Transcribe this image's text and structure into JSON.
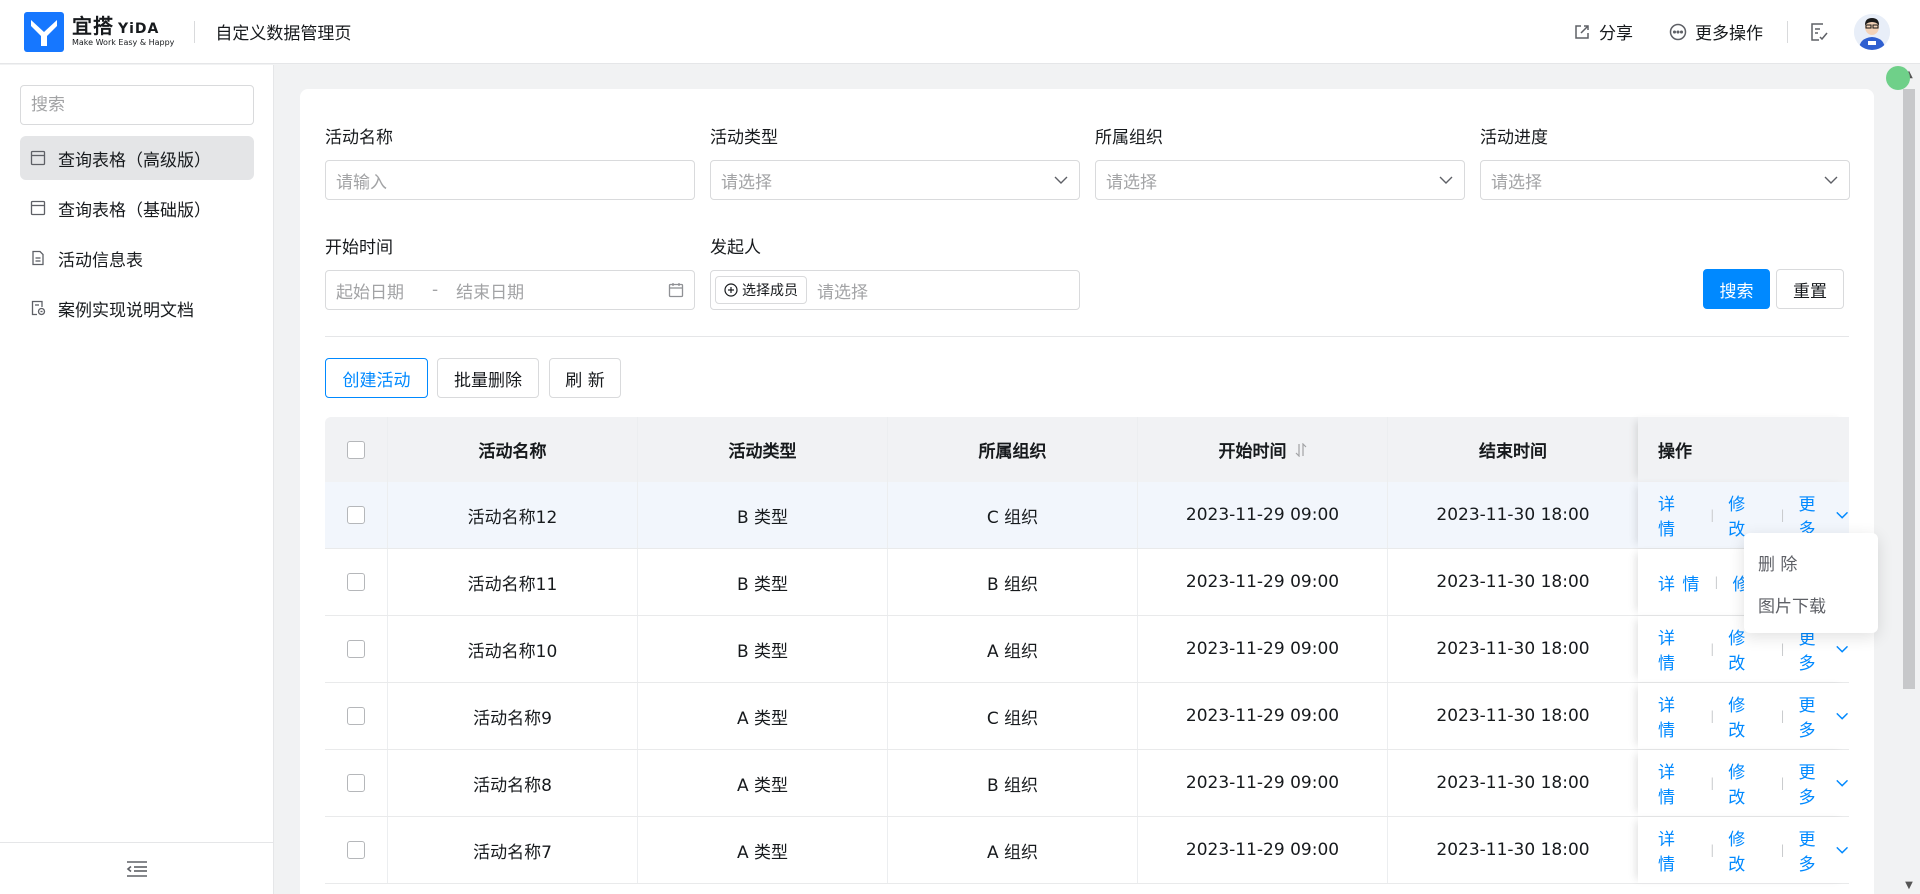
{
  "header": {
    "logo_cn": "宜搭",
    "logo_en": "YiDA",
    "slogan": "Make Work Easy & Happy",
    "app_title": "自定义数据管理页",
    "share_label": "分享",
    "more_label": "更多操作"
  },
  "sidebar": {
    "search_placeholder": "搜索",
    "items": [
      {
        "label": "查询表格（高级版）",
        "active": true
      },
      {
        "label": "查询表格（基础版）",
        "active": false
      },
      {
        "label": "活动信息表",
        "active": false
      },
      {
        "label": "案例实现说明文档",
        "active": false
      }
    ]
  },
  "filters": {
    "name_label": "活动名称",
    "name_placeholder": "请输入",
    "type_label": "活动类型",
    "type_placeholder": "请选择",
    "org_label": "所属组织",
    "org_placeholder": "请选择",
    "progress_label": "活动进度",
    "progress_placeholder": "请选择",
    "time_label": "开始时间",
    "start_placeholder": "起始日期",
    "range_sep": "-",
    "end_placeholder": "结束日期",
    "initiator_label": "发起人",
    "member_button": "选择成员",
    "initiator_placeholder": "请选择",
    "search_button": "搜索",
    "reset_button": "重置"
  },
  "toolbar": {
    "create": "创建活动",
    "batch_delete": "批量删除",
    "refresh": "刷 新"
  },
  "table": {
    "columns": [
      "活动名称",
      "活动类型",
      "所属组织",
      "开始时间",
      "结束时间",
      "操作"
    ],
    "rows": [
      {
        "name": "活动名称12",
        "type": "B 类型",
        "org": "C 组织",
        "start": "2023-11-29 09:00",
        "end": "2023-11-30 18:00"
      },
      {
        "name": "活动名称11",
        "type": "B 类型",
        "org": "B 组织",
        "start": "2023-11-29 09:00",
        "end": "2023-11-30 18:00"
      },
      {
        "name": "活动名称10",
        "type": "B 类型",
        "org": "A 组织",
        "start": "2023-11-29 09:00",
        "end": "2023-11-30 18:00"
      },
      {
        "name": "活动名称9",
        "type": "A 类型",
        "org": "C 组织",
        "start": "2023-11-29 09:00",
        "end": "2023-11-30 18:00"
      },
      {
        "name": "活动名称8",
        "type": "A 类型",
        "org": "B 组织",
        "start": "2023-11-29 09:00",
        "end": "2023-11-30 18:00"
      },
      {
        "name": "活动名称7",
        "type": "A 类型",
        "org": "A 组织",
        "start": "2023-11-29 09:00",
        "end": "2023-11-30 18:00"
      }
    ],
    "op_detail": "详 情",
    "op_edit": "修 改",
    "op_more": "更多"
  },
  "dropdown": {
    "items": [
      "删 除",
      "图片下载"
    ]
  },
  "colors": {
    "primary": "#0089ff",
    "logo_blue": "#1677ff"
  }
}
